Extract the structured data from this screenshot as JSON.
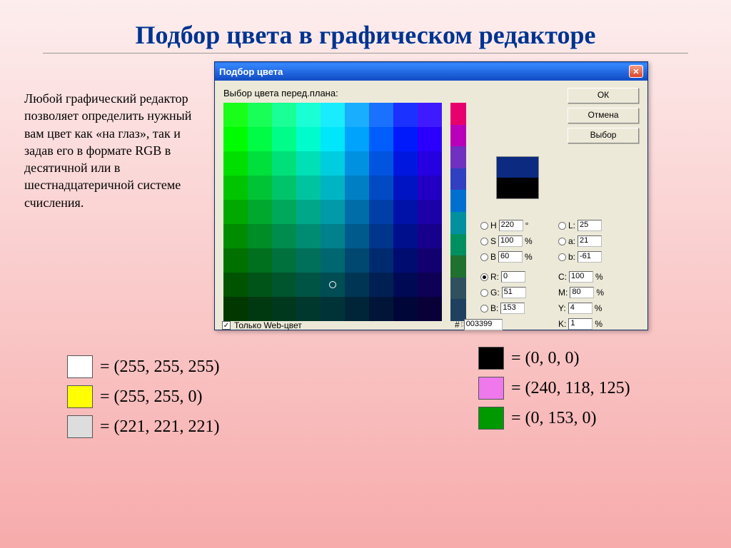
{
  "slide": {
    "title": "Подбор цвета в графическом редакторе",
    "sidetext": "Любой графический редактор позволяет определить нужный вам цвет как «на глаз», так и задав его в формате RGB в десятичной или в шестнадцатеричной системе счисления."
  },
  "dialog": {
    "title": "Подбор цвета",
    "picker_label": "Выбор цвета перед.плана:",
    "ok": "ОК",
    "cancel": "Отмена",
    "select": "Выбор",
    "webonly": "Только Web-цвет",
    "preview": {
      "top": "#0b2a80",
      "bottom": "#000000"
    },
    "fields": {
      "H": "220",
      "H_unit": "°",
      "L": "25",
      "S": "100",
      "S_unit": "%",
      "a": "21",
      "B": "60",
      "B_unit": "%",
      "b": "-61",
      "R": "0",
      "C": "100",
      "G": "51",
      "M": "80",
      "Bv": "153",
      "Y": "4",
      "hex": "003399",
      "K": "1",
      "pct": "%"
    }
  },
  "swatches": {
    "left": [
      {
        "color": "#ffffff",
        "text": "= (255, 255, 255)"
      },
      {
        "color": "#ffff00",
        "text": "= (255, 255, 0)"
      },
      {
        "color": "#dddddd",
        "text": "= (221, 221, 221)"
      }
    ],
    "right": [
      {
        "color": "#000000",
        "text": "= (0, 0, 0)"
      },
      {
        "color": "#ef78ec",
        "text": "= (240, 118, 125)"
      },
      {
        "color": "#009900",
        "text": "= (0, 153, 0)"
      }
    ]
  },
  "chart_data": {
    "type": "table",
    "title": "RGB color examples",
    "series": [
      {
        "name": "white",
        "values": [
          255,
          255,
          255
        ]
      },
      {
        "name": "yellow",
        "values": [
          255,
          255,
          0
        ]
      },
      {
        "name": "light-grey",
        "values": [
          221,
          221,
          221
        ]
      },
      {
        "name": "black",
        "values": [
          0,
          0,
          0
        ]
      },
      {
        "name": "pink",
        "values": [
          240,
          118,
          125
        ]
      },
      {
        "name": "green",
        "values": [
          0,
          153,
          0
        ]
      }
    ]
  }
}
